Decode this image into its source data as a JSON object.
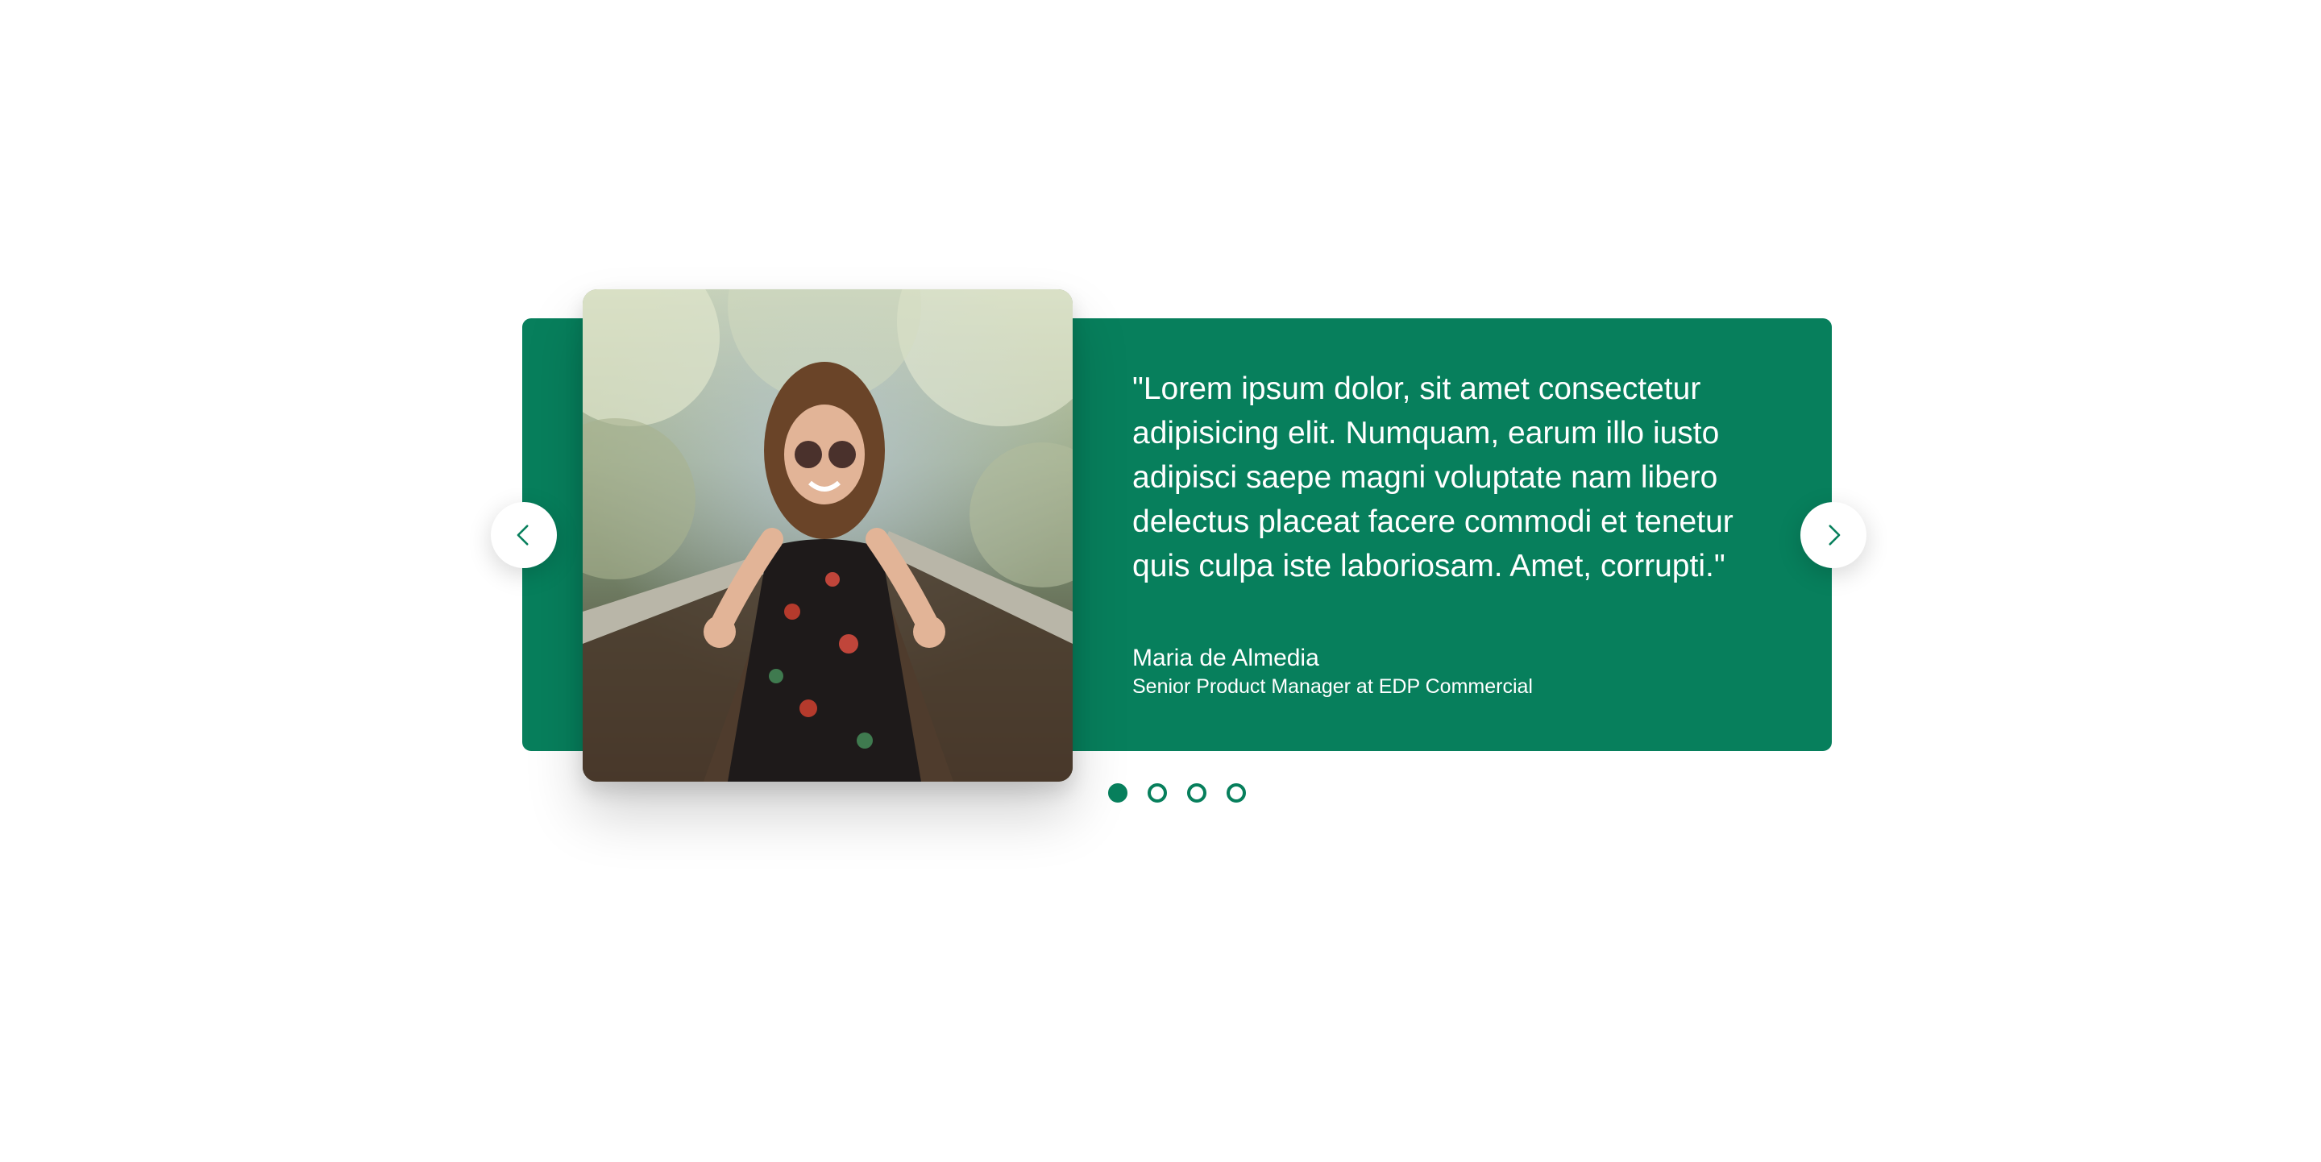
{
  "testimonial": {
    "quote": "\"Lorem ipsum dolor, sit amet consectetur adipisicing elit. Numquam, earum illo iusto adipisci saepe magni voluptate nam libero delectus placeat facere commodi et tenetur quis culpa iste laboriosam. Amet, corrupti.\"",
    "author_name": "Maria de Almedia",
    "author_role": "Senior Product Manager at EDP Commercial"
  },
  "navigation": {
    "prev_icon": "chevron-left-icon",
    "next_icon": "chevron-right-icon"
  },
  "pagination": {
    "total": 4,
    "active_index": 0
  },
  "colors": {
    "accent": "#077f5c",
    "background": "#ffffff",
    "text_on_accent": "#ffffff"
  }
}
